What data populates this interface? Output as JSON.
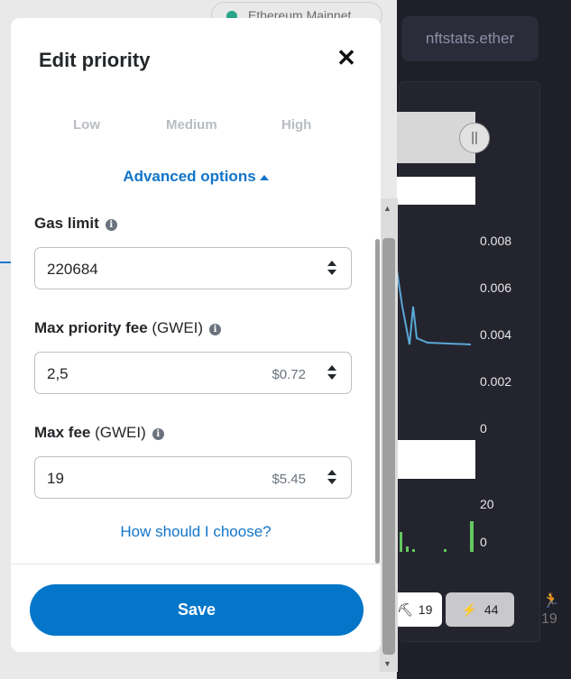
{
  "background": {
    "network": "Ethereum Mainnet",
    "ens_name": "nftstats.ether",
    "chart_axis": [
      "0.008",
      "0.006",
      "0.004",
      "0.002",
      "0"
    ],
    "count_axis": [
      "20",
      "0"
    ],
    "fee_options": [
      {
        "icon": "walker-icon",
        "value": "19"
      },
      {
        "icon": "lightning-icon",
        "value": "44"
      }
    ],
    "runner_value": "19",
    "toggle_symbol": "||"
  },
  "modal": {
    "title": "Edit priority",
    "close_symbol": "✕",
    "tabs": [
      "Low",
      "Medium",
      "High"
    ],
    "advanced_label": "Advanced options",
    "gas_limit": {
      "label": "Gas limit",
      "value": "220684"
    },
    "max_priority_fee": {
      "label": "Max priority fee",
      "unit": "(GWEI)",
      "value": "2,5",
      "usd": "$0.72"
    },
    "max_fee": {
      "label": "Max fee",
      "unit": "(GWEI)",
      "value": "19",
      "usd": "$5.45"
    },
    "help_link": "How should I choose?",
    "save_label": "Save"
  },
  "colors": {
    "accent": "#0376c9",
    "link": "#1175c9",
    "chart_line": "#5aa9d6",
    "bar_green": "#63c85e",
    "network_dot": "#2aa489"
  }
}
